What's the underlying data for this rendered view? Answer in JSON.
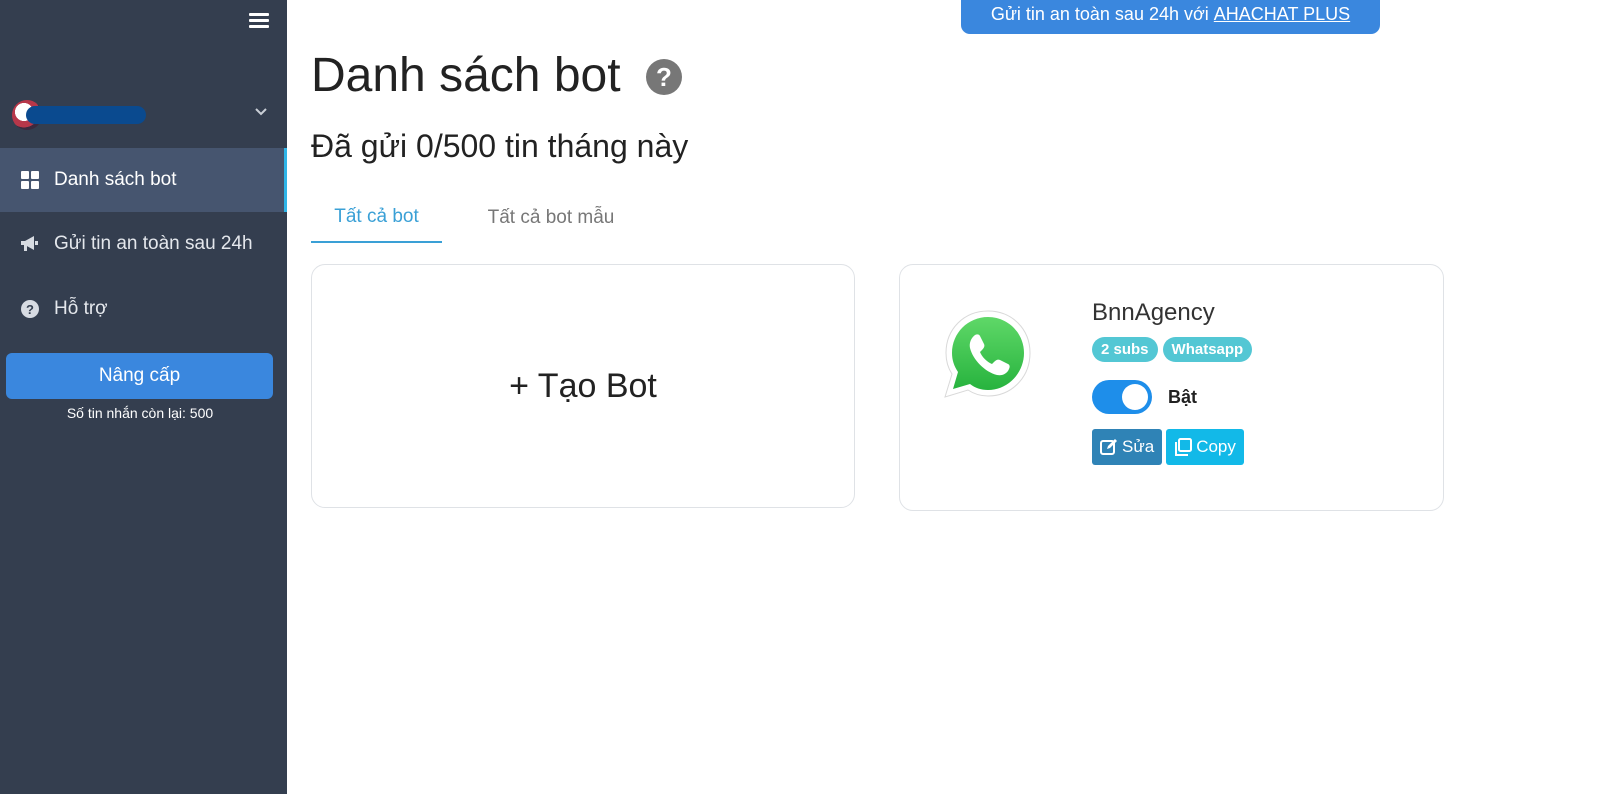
{
  "banner": {
    "text": "Gửi tin an toàn sau 24h với",
    "link": "AHACHAT PLUS"
  },
  "sidebar": {
    "items": [
      {
        "label": "Danh sách bot",
        "icon": "dashboard-grid-icon",
        "active": true
      },
      {
        "label": "Gửi tin an toàn sau 24h",
        "icon": "megaphone-icon",
        "active": false
      },
      {
        "label": "Hỗ trợ",
        "icon": "question-circle-icon",
        "active": false
      }
    ],
    "upgrade_label": "Nâng cấp",
    "remaining": "Số tin nhắn còn lại: 500"
  },
  "main": {
    "title": "Danh sách bot",
    "subtitle": "Đã gửi 0/500 tin tháng này",
    "tabs": [
      {
        "label": "Tất cả bot",
        "active": true
      },
      {
        "label": "Tất cả bot mẫu",
        "active": false
      }
    ],
    "create_label": "+ Tạo Bot",
    "bot": {
      "name": "BnnAgency",
      "badges": [
        "2 subs",
        "Whatsapp"
      ],
      "status_label": "Bật",
      "enabled": true,
      "edit_label": "Sửa",
      "copy_label": "Copy"
    }
  },
  "colors": {
    "sidebar_bg": "#343e4f",
    "accent": "#3a87de",
    "tab_active": "#3aa0d6",
    "badge": "#53c7d4",
    "toggle_on": "#1e8eea"
  }
}
